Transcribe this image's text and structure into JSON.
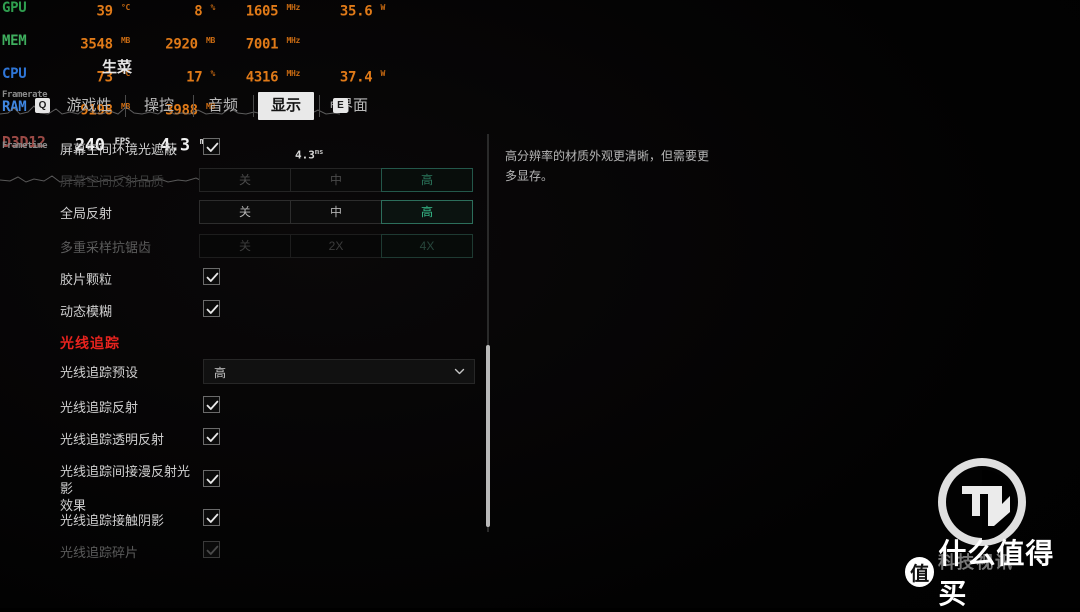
{
  "osd": {
    "rows": [
      {
        "label": "GPU",
        "color": "gpu",
        "metrics": [
          {
            "value": "39",
            "unit": "°C"
          },
          {
            "value": "8",
            "unit": "%"
          },
          {
            "value": "1605",
            "unit": "MHz"
          },
          {
            "value": "35.6",
            "unit": "W"
          }
        ]
      },
      {
        "label": "MEM",
        "color": "mem",
        "metrics": [
          {
            "value": "3548",
            "unit": "MB"
          },
          {
            "value": "2920",
            "unit": "MB"
          },
          {
            "value": "7001",
            "unit": "MHz"
          },
          {
            "value": "",
            "unit": ""
          }
        ]
      },
      {
        "label": "CPU",
        "color": "cpu",
        "metrics": [
          {
            "value": "73",
            "unit": "°C"
          },
          {
            "value": "17",
            "unit": "%"
          },
          {
            "value": "4316",
            "unit": "MHz"
          },
          {
            "value": "37.4",
            "unit": "W"
          }
        ]
      },
      {
        "label": "RAM",
        "color": "ram",
        "metrics": [
          {
            "value": "9198",
            "unit": "MB"
          },
          {
            "value": "3988",
            "unit": "MB"
          },
          {
            "value": "",
            "unit": ""
          },
          {
            "value": "",
            "unit": ""
          }
        ]
      }
    ],
    "api_label": "D3D12",
    "fps": {
      "value": "240",
      "unit": "FPS"
    },
    "frametime": {
      "value": "4.3",
      "unit": "ms"
    },
    "framerate_graph_label": "Framerate",
    "frametime_graph_label": "Frametime",
    "frametime_overlay_value": "4.3",
    "frametime_overlay_unit": "ms",
    "nickname_watermark": "生菜",
    "key_ghost_fps": "FPS"
  },
  "tabs": {
    "items": [
      {
        "label": "游戏性",
        "selected": false
      },
      {
        "label": "操控",
        "selected": false
      },
      {
        "label": "音频",
        "selected": false
      },
      {
        "label": "显示",
        "selected": true
      },
      {
        "label": "界面",
        "selected": false
      }
    ],
    "key_prev": "Q",
    "key_next": "E"
  },
  "settings": {
    "rows": [
      {
        "label": "屏幕空间环境光遮蔽",
        "type": "checkbox",
        "checked": true,
        "state": "normal"
      },
      {
        "label": "屏幕空间反射品质",
        "type": "segment",
        "options": [
          "关",
          "中",
          "高"
        ],
        "selected": 2,
        "state": "ghost"
      },
      {
        "label": "全局反射",
        "type": "segment",
        "options": [
          "关",
          "中",
          "高"
        ],
        "selected": 2,
        "state": "normal"
      },
      {
        "label": "多重采样抗锯齿",
        "type": "segment",
        "options": [
          "关",
          "2X",
          "4X"
        ],
        "selected": 2,
        "state": "disabled"
      },
      {
        "label": "胶片颗粒",
        "type": "checkbox",
        "checked": true,
        "state": "normal"
      },
      {
        "label": "动态模糊",
        "type": "checkbox",
        "checked": true,
        "state": "normal"
      }
    ],
    "section_header": "光线追踪",
    "rt_rows": [
      {
        "label": "光线追踪预设",
        "type": "dropdown",
        "value": "高",
        "state": "normal"
      },
      {
        "label": "光线追踪反射",
        "type": "checkbox",
        "checked": true,
        "state": "normal"
      },
      {
        "label": "光线追踪透明反射",
        "type": "checkbox",
        "checked": true,
        "state": "normal"
      },
      {
        "label": "光线追踪间接漫反射光影\n效果",
        "type": "checkbox",
        "checked": true,
        "state": "normal"
      },
      {
        "label": "光线追踪接触阴影",
        "type": "checkbox",
        "checked": true,
        "state": "normal"
      },
      {
        "label": "光线追踪碎片",
        "type": "checkbox",
        "checked": true,
        "state": "disabled"
      }
    ]
  },
  "description": "高分辨率的材质外观更清晰，但需要更多显存。",
  "watermark": {
    "tech_text": "科技视讯",
    "smzdm_badge": "值",
    "smzdm_text": "什么值得买"
  }
}
